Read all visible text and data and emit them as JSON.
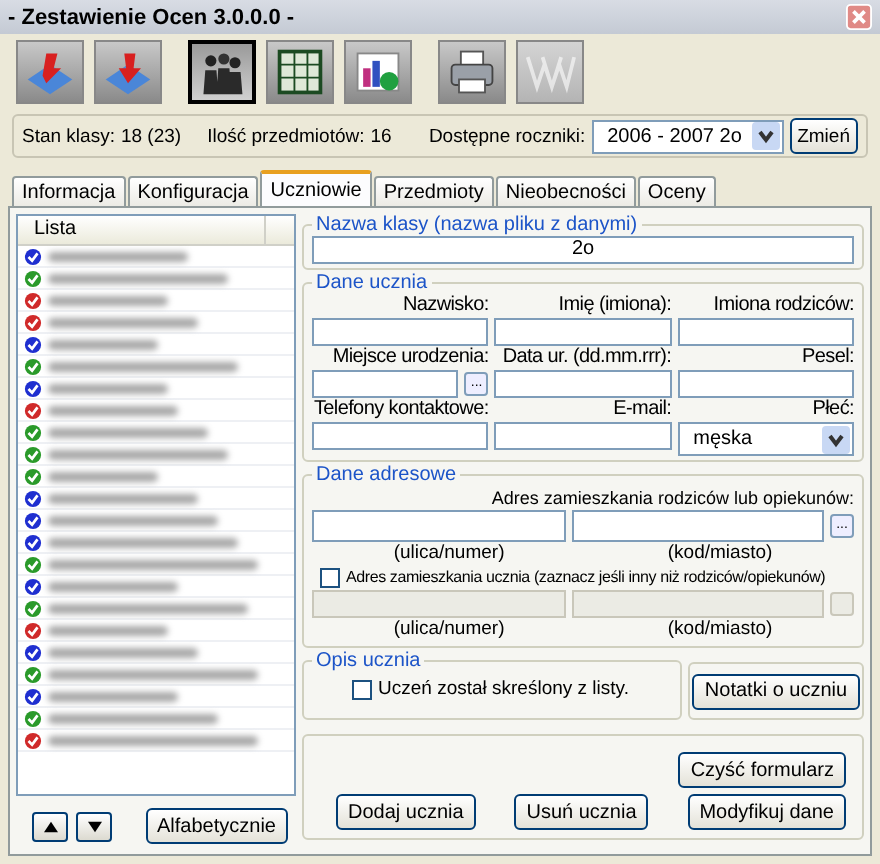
{
  "window": {
    "title": "- Zestawienie Ocen 3.0.0.0 -"
  },
  "toolbar": [
    {
      "kind": "import",
      "selected": false,
      "disabled": false
    },
    {
      "kind": "export",
      "selected": false,
      "disabled": false
    },
    {
      "kind": "people",
      "selected": true,
      "disabled": false
    },
    {
      "kind": "sheet",
      "selected": false,
      "disabled": false
    },
    {
      "kind": "chart",
      "selected": false,
      "disabled": false
    },
    {
      "kind": "printer",
      "selected": false,
      "disabled": false
    },
    {
      "kind": "web",
      "selected": false,
      "disabled": true
    }
  ],
  "info": {
    "class_label": "Stan klasy:",
    "class_value": "18 (23)",
    "subjects_label": "Ilość przedmiotów:",
    "subjects_value": "16",
    "years_label": "Dostępne roczniki:",
    "years_value": "2006 - 2007  2o",
    "change_button": "Zmień"
  },
  "tabs": [
    {
      "label": "Informacja",
      "selected": false
    },
    {
      "label": "Konfiguracja",
      "selected": false
    },
    {
      "label": "Uczniowie",
      "selected": true
    },
    {
      "label": "Przedmioty",
      "selected": false
    },
    {
      "label": "Nieobecności",
      "selected": false
    },
    {
      "label": "Oceny",
      "selected": false
    }
  ],
  "list": {
    "header": "Lista",
    "rows": [
      {
        "color": "#1f2fd0"
      },
      {
        "color": "#2a9a2a"
      },
      {
        "color": "#d02a2a"
      },
      {
        "color": "#d02a2a"
      },
      {
        "color": "#1f2fd0"
      },
      {
        "color": "#2a9a2a"
      },
      {
        "color": "#1f2fd0"
      },
      {
        "color": "#d02a2a"
      },
      {
        "color": "#2a9a2a"
      },
      {
        "color": "#2a9a2a"
      },
      {
        "color": "#2a9a2a"
      },
      {
        "color": "#1f2fd0"
      },
      {
        "color": "#1f2fd0"
      },
      {
        "color": "#1f2fd0"
      },
      {
        "color": "#2a9a2a"
      },
      {
        "color": "#1f2fd0"
      },
      {
        "color": "#2a9a2a"
      },
      {
        "color": "#d02a2a"
      },
      {
        "color": "#1f2fd0"
      },
      {
        "color": "#2a9a2a"
      },
      {
        "color": "#1f2fd0"
      },
      {
        "color": "#2a9a2a"
      },
      {
        "color": "#d02a2a"
      }
    ],
    "sort_button": "Alfabetycznie"
  },
  "class_group": {
    "legend": "Nazwa klasy (nazwa pliku z danymi)",
    "value": "2o"
  },
  "student_group": {
    "legend": "Dane ucznia",
    "fields": [
      {
        "label": "Nazwisko:",
        "kind": "text"
      },
      {
        "label": "Imię (imiona):",
        "kind": "text"
      },
      {
        "label": "Imiona rodziców:",
        "kind": "text"
      },
      {
        "label": "Miejsce urodzenia:",
        "kind": "browse",
        "button": "..."
      },
      {
        "label": "Data ur. (dd.mm.rrr):",
        "kind": "text"
      },
      {
        "label": "Pesel:",
        "kind": "text"
      },
      {
        "label": "Telefony kontaktowe:",
        "kind": "text"
      },
      {
        "label": "E-mail:",
        "kind": "text"
      },
      {
        "label": "Płeć:",
        "kind": "select",
        "value": "męska"
      }
    ]
  },
  "address_group": {
    "legend": "Dane adresowe",
    "parents_label": "Adres zamieszkania rodziców lub opiekunów:",
    "browse_button": "...",
    "street_caption": "(ulica/numer)",
    "city_caption": "(kod/miasto)",
    "own_address": {
      "label": "Adres zamieszkania ucznia (zaznacz jeśli inny niż rodziców/opiekunów)",
      "checked": false
    },
    "street_caption_2": "(ulica/numer)",
    "city_caption_2": "(kod/miasto)"
  },
  "description_group": {
    "legend": "Opis ucznia",
    "removed": {
      "label": "Uczeń został skreślony z listy.",
      "checked": false
    },
    "notes_button": "Notatki o uczniu"
  },
  "actions": {
    "clear": "Czyść formularz",
    "add": "Dodaj ucznia",
    "remove": "Usuń ucznia",
    "modify": "Modyfikuj dane"
  }
}
